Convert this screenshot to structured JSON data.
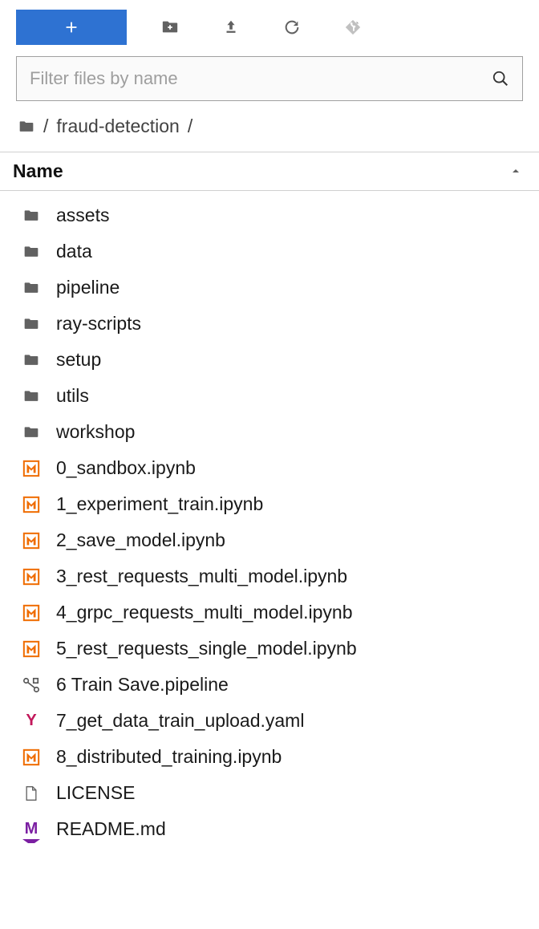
{
  "filter": {
    "placeholder": "Filter files by name"
  },
  "breadcrumb": {
    "sep1": "/",
    "folder": "fraud-detection",
    "sep2": "/"
  },
  "header": {
    "name": "Name"
  },
  "items": [
    {
      "name": "assets",
      "type": "folder"
    },
    {
      "name": "data",
      "type": "folder"
    },
    {
      "name": "pipeline",
      "type": "folder"
    },
    {
      "name": "ray-scripts",
      "type": "folder"
    },
    {
      "name": "setup",
      "type": "folder"
    },
    {
      "name": "utils",
      "type": "folder"
    },
    {
      "name": "workshop",
      "type": "folder"
    },
    {
      "name": "0_sandbox.ipynb",
      "type": "notebook"
    },
    {
      "name": "1_experiment_train.ipynb",
      "type": "notebook"
    },
    {
      "name": "2_save_model.ipynb",
      "type": "notebook"
    },
    {
      "name": "3_rest_requests_multi_model.ipynb",
      "type": "notebook"
    },
    {
      "name": "4_grpc_requests_multi_model.ipynb",
      "type": "notebook"
    },
    {
      "name": "5_rest_requests_single_model.ipynb",
      "type": "notebook"
    },
    {
      "name": "6 Train Save.pipeline",
      "type": "pipeline"
    },
    {
      "name": "7_get_data_train_upload.yaml",
      "type": "yaml"
    },
    {
      "name": "8_distributed_training.ipynb",
      "type": "notebook"
    },
    {
      "name": "LICENSE",
      "type": "text"
    },
    {
      "name": "README.md",
      "type": "markdown"
    }
  ],
  "icons": {
    "yaml_letter": "Y",
    "md_letter": "M"
  }
}
